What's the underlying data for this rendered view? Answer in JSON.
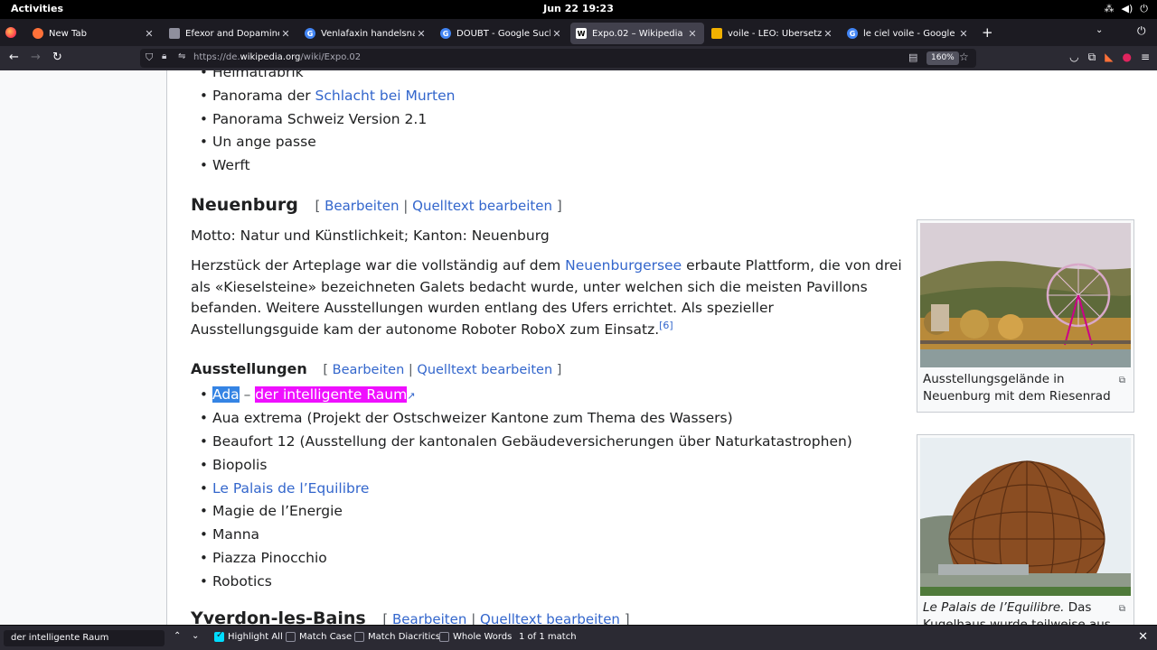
{
  "topbar": {
    "activities": "Activities",
    "clock": "Jun 22  19:23"
  },
  "tabs": [
    {
      "title": "New Tab",
      "favicon": "firefox-icon",
      "color": "#ff7139"
    },
    {
      "title": "Efexor and Dopamine Inte",
      "favicon": "document-icon",
      "color": "#8f8f9d"
    },
    {
      "title": "Venlafaxin handelsnamen",
      "favicon": "google-icon",
      "color": "#4285f4"
    },
    {
      "title": "DOUBT - Google Suche",
      "favicon": "google-icon",
      "color": "#4285f4"
    },
    {
      "title": "Expo.02 – Wikipedia",
      "favicon": "wikipedia-icon",
      "color": "#ffffff",
      "active": true
    },
    {
      "title": "voile - LEO: Übersetzung",
      "favicon": "leo-icon",
      "color": "#f0b000"
    },
    {
      "title": "le ciel voile - Google Such",
      "favicon": "google-icon",
      "color": "#4285f4"
    }
  ],
  "navbar": {
    "url_prefix": "https://de.",
    "url_host": "wikipedia.org",
    "url_path": "/wiki/Expo.02",
    "zoom": "160%"
  },
  "content": {
    "top_list": [
      "Heimatfabrik",
      "Panorama der ",
      "Panorama Schweiz Version 2.1",
      "Un ange passe",
      "Werft"
    ],
    "top_list_link": "Schlacht bei Murten",
    "edit_open": "[",
    "edit_close": "]",
    "edit_sep": "|",
    "edit_label": "Bearbeiten",
    "source_label": "Quelltext bearbeiten",
    "neuenburg_heading": "Neuenburg",
    "motto": "Motto: Natur und Künstlichkeit; Kanton: Neuenburg",
    "para_1": "Herzstück der Arteplage war die vollständig auf dem ",
    "para_link": "Neuenburgersee",
    "para_2": " erbaute Plattform, die von drei als «Kieselsteine» bezeichneten Galets bedacht wurde, unter welchen sich die meisten Pavillons befanden. Weitere Ausstellungen wurden entlang des Ufers errichtet. Als spezieller Ausstellungsguide kam der autonome Roboter RoboX zum Einsatz.",
    "para_ref": "[6]",
    "ausstellungen_heading": "Ausstellungen",
    "exhibit_first_a": "Ada",
    "exhibit_first_dash": " – ",
    "exhibit_first_b": "der intelligente Raum",
    "exhibits": [
      "Aua extrema (Projekt der Ostschweizer Kantone zum Thema des Wassers)",
      "Beaufort 12 (Ausstellung der kantonalen Gebäudeversicherungen über Naturkatastrophen)",
      "Biopolis"
    ],
    "exhibit_link": "Le Palais de l’Equilibre",
    "exhibits_after": [
      "Magie de l’Energie",
      "Manna",
      "Piazza Pinocchio",
      "Robotics"
    ],
    "yverdon_heading": "Yverdon-les-Bains"
  },
  "thumbs": {
    "caption_1": "Ausstellungsgelände in Neuenburg mit dem Riesenrad",
    "caption_2_italic": "Le Palais de l’Equilibre.",
    "caption_2_rest": " Das Kugelhaus wurde teilweise aus"
  },
  "findbar": {
    "query": "der intelligente Raum",
    "highlight_all": "Highlight All",
    "match_case": "Match Case",
    "match_diacritics": "Match Diacritics",
    "whole_words": "Whole Words",
    "status": "1 of 1 match"
  },
  "colors": {
    "link": "#3366cc",
    "find_highlight": "#ef0fff",
    "selection": "#3584e4"
  }
}
